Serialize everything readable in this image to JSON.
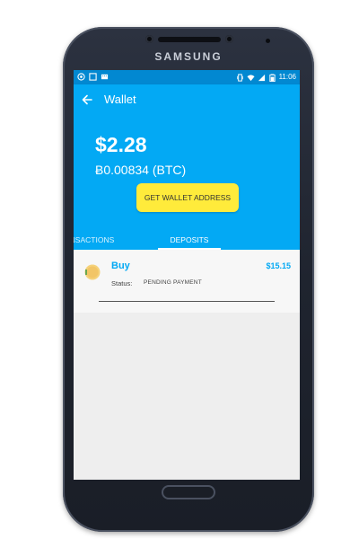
{
  "device": {
    "brand": "SAMSUNG"
  },
  "statusbar": {
    "time": "11:06",
    "left_icons": [
      "whatsapp-icon",
      "square-icon",
      "keyboard-icon"
    ],
    "right_icons": [
      "vibrate-icon",
      "wifi-icon",
      "signal-icon",
      "battery-icon"
    ]
  },
  "appbar": {
    "title": "Wallet",
    "back_icon": "arrow-left-icon"
  },
  "wallet": {
    "balance_usd": "$2.28",
    "balance_btc": "Ƀ0.00834  (BTC)",
    "get_address_label": "GET WALLET ADDRESS"
  },
  "tabs": [
    {
      "label": "ANSACTIONS",
      "selected": false
    },
    {
      "label": "DEPOSITS",
      "selected": true
    }
  ],
  "deposits": [
    {
      "title": "Buy",
      "amount": "$15.15",
      "status_label": "Status:",
      "status_value": "PENDING PAYMENT",
      "icon": "coin-icon"
    }
  ],
  "colors": {
    "primary": "#03a9f4",
    "status_bar": "#0288d1",
    "accent_button": "#ffeb3b",
    "background": "#eeeeee"
  }
}
